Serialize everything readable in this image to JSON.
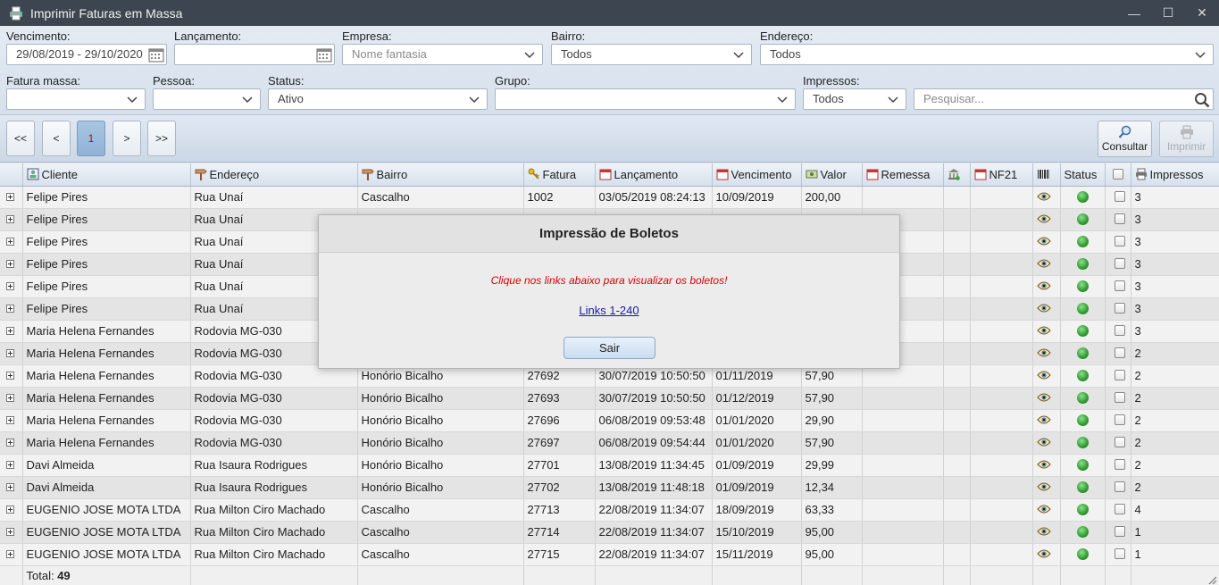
{
  "window": {
    "title": "Imprimir Faturas em Massa",
    "minimize": "—",
    "maximize": "☐",
    "close": "✕"
  },
  "filters": {
    "vencimento": {
      "label": "Vencimento:",
      "value": "29/08/2019 - 29/10/2020"
    },
    "lancamento": {
      "label": "Lançamento:",
      "value": ""
    },
    "empresa": {
      "label": "Empresa:",
      "placeholder": "Nome fantasia"
    },
    "bairro": {
      "label": "Bairro:",
      "value": "Todos"
    },
    "endereco": {
      "label": "Endereço:",
      "value": "Todos"
    },
    "fatura_massa": {
      "label": "Fatura massa:",
      "value": ""
    },
    "pessoa": {
      "label": "Pessoa:",
      "value": ""
    },
    "status": {
      "label": "Status:",
      "value": "Ativo"
    },
    "grupo": {
      "label": "Grupo:",
      "value": ""
    },
    "impressos": {
      "label": "Impressos:",
      "value": "Todos"
    },
    "search": {
      "placeholder": "Pesquisar..."
    }
  },
  "pagination": {
    "first": "<<",
    "prev": "<",
    "current": "1",
    "next": ">",
    "last": ">>"
  },
  "actions": {
    "consultar": "Consultar",
    "imprimir": "Imprimir"
  },
  "columns": {
    "cliente": "Cliente",
    "endereco": "Endereço",
    "bairro": "Bairro",
    "fatura": "Fatura",
    "lancamento": "Lançamento",
    "vencimento": "Vencimento",
    "valor": "Valor",
    "remessa": "Remessa",
    "nf21": "NF21",
    "status": "Status",
    "impressos": "Impressos"
  },
  "rows": [
    {
      "cliente": "Felipe Pires",
      "endereco": "Rua Unaí",
      "bairro": "Cascalho",
      "fatura": "1002",
      "lancamento": "03/05/2019 08:24:13",
      "vencimento": "10/09/2019",
      "valor": "200,00",
      "impressos": "3"
    },
    {
      "cliente": "Felipe Pires",
      "endereco": "Rua Unaí",
      "bairro": "",
      "fatura": "",
      "lancamento": "",
      "vencimento": "",
      "valor": "",
      "impressos": "3"
    },
    {
      "cliente": "Felipe Pires",
      "endereco": "Rua Unaí",
      "bairro": "",
      "fatura": "",
      "lancamento": "",
      "vencimento": "",
      "valor": "",
      "impressos": "3"
    },
    {
      "cliente": "Felipe Pires",
      "endereco": "Rua Unaí",
      "bairro": "",
      "fatura": "",
      "lancamento": "",
      "vencimento": "",
      "valor": "",
      "impressos": "3"
    },
    {
      "cliente": "Felipe Pires",
      "endereco": "Rua Unaí",
      "bairro": "",
      "fatura": "",
      "lancamento": "",
      "vencimento": "",
      "valor": "",
      "impressos": "3"
    },
    {
      "cliente": "Felipe Pires",
      "endereco": "Rua Unaí",
      "bairro": "",
      "fatura": "",
      "lancamento": "",
      "vencimento": "",
      "valor": "",
      "impressos": "3"
    },
    {
      "cliente": "Maria Helena Fernandes",
      "endereco": "Rodovia MG-030",
      "bairro": "",
      "fatura": "",
      "lancamento": "",
      "vencimento": "",
      "valor": "",
      "impressos": "3"
    },
    {
      "cliente": "Maria Helena Fernandes",
      "endereco": "Rodovia MG-030",
      "bairro": "",
      "fatura": "",
      "lancamento": "",
      "vencimento": "",
      "valor": "",
      "impressos": "2"
    },
    {
      "cliente": "Maria Helena Fernandes",
      "endereco": "Rodovia MG-030",
      "bairro": "Honório Bicalho",
      "fatura": "27692",
      "lancamento": "30/07/2019 10:50:50",
      "vencimento": "01/11/2019",
      "valor": "57,90",
      "impressos": "2"
    },
    {
      "cliente": "Maria Helena Fernandes",
      "endereco": "Rodovia MG-030",
      "bairro": "Honório Bicalho",
      "fatura": "27693",
      "lancamento": "30/07/2019 10:50:50",
      "vencimento": "01/12/2019",
      "valor": "57,90",
      "impressos": "2"
    },
    {
      "cliente": "Maria Helena Fernandes",
      "endereco": "Rodovia MG-030",
      "bairro": "Honório Bicalho",
      "fatura": "27696",
      "lancamento": "06/08/2019 09:53:48",
      "vencimento": "01/01/2020",
      "valor": "29,90",
      "impressos": "2"
    },
    {
      "cliente": "Maria Helena Fernandes",
      "endereco": "Rodovia MG-030",
      "bairro": "Honório Bicalho",
      "fatura": "27697",
      "lancamento": "06/08/2019 09:54:44",
      "vencimento": "01/01/2020",
      "valor": "57,90",
      "impressos": "2"
    },
    {
      "cliente": "Davi Almeida",
      "endereco": "Rua Isaura Rodrigues",
      "bairro": "Honório Bicalho",
      "fatura": "27701",
      "lancamento": "13/08/2019 11:34:45",
      "vencimento": "01/09/2019",
      "valor": "29,99",
      "impressos": "2"
    },
    {
      "cliente": "Davi Almeida",
      "endereco": "Rua Isaura Rodrigues",
      "bairro": "Honório Bicalho",
      "fatura": "27702",
      "lancamento": "13/08/2019 11:48:18",
      "vencimento": "01/09/2019",
      "valor": "12,34",
      "impressos": "2"
    },
    {
      "cliente": "EUGENIO JOSE MOTA LTDA",
      "endereco": "Rua Milton Ciro Machado",
      "bairro": "Cascalho",
      "fatura": "27713",
      "lancamento": "22/08/2019 11:34:07",
      "vencimento": "18/09/2019",
      "valor": "63,33",
      "impressos": "4"
    },
    {
      "cliente": "EUGENIO JOSE MOTA LTDA",
      "endereco": "Rua Milton Ciro Machado",
      "bairro": "Cascalho",
      "fatura": "27714",
      "lancamento": "22/08/2019 11:34:07",
      "vencimento": "15/10/2019",
      "valor": "95,00",
      "impressos": "1"
    },
    {
      "cliente": "EUGENIO JOSE MOTA LTDA",
      "endereco": "Rua Milton Ciro Machado",
      "bairro": "Cascalho",
      "fatura": "27715",
      "lancamento": "22/08/2019 11:34:07",
      "vencimento": "15/11/2019",
      "valor": "95,00",
      "impressos": "1"
    }
  ],
  "total": {
    "label": "Total: ",
    "value": "49"
  },
  "dialog": {
    "title": "Impressão de Boletos",
    "message": "Clique nos links abaixo para visualizar os boletos!",
    "link": "Links 1-240",
    "button": "Sair"
  },
  "colors": {
    "titlebar": "#3d4650",
    "status_ok": "#2e9a2e",
    "message": "#dd0000",
    "link": "#1a1aa6"
  }
}
